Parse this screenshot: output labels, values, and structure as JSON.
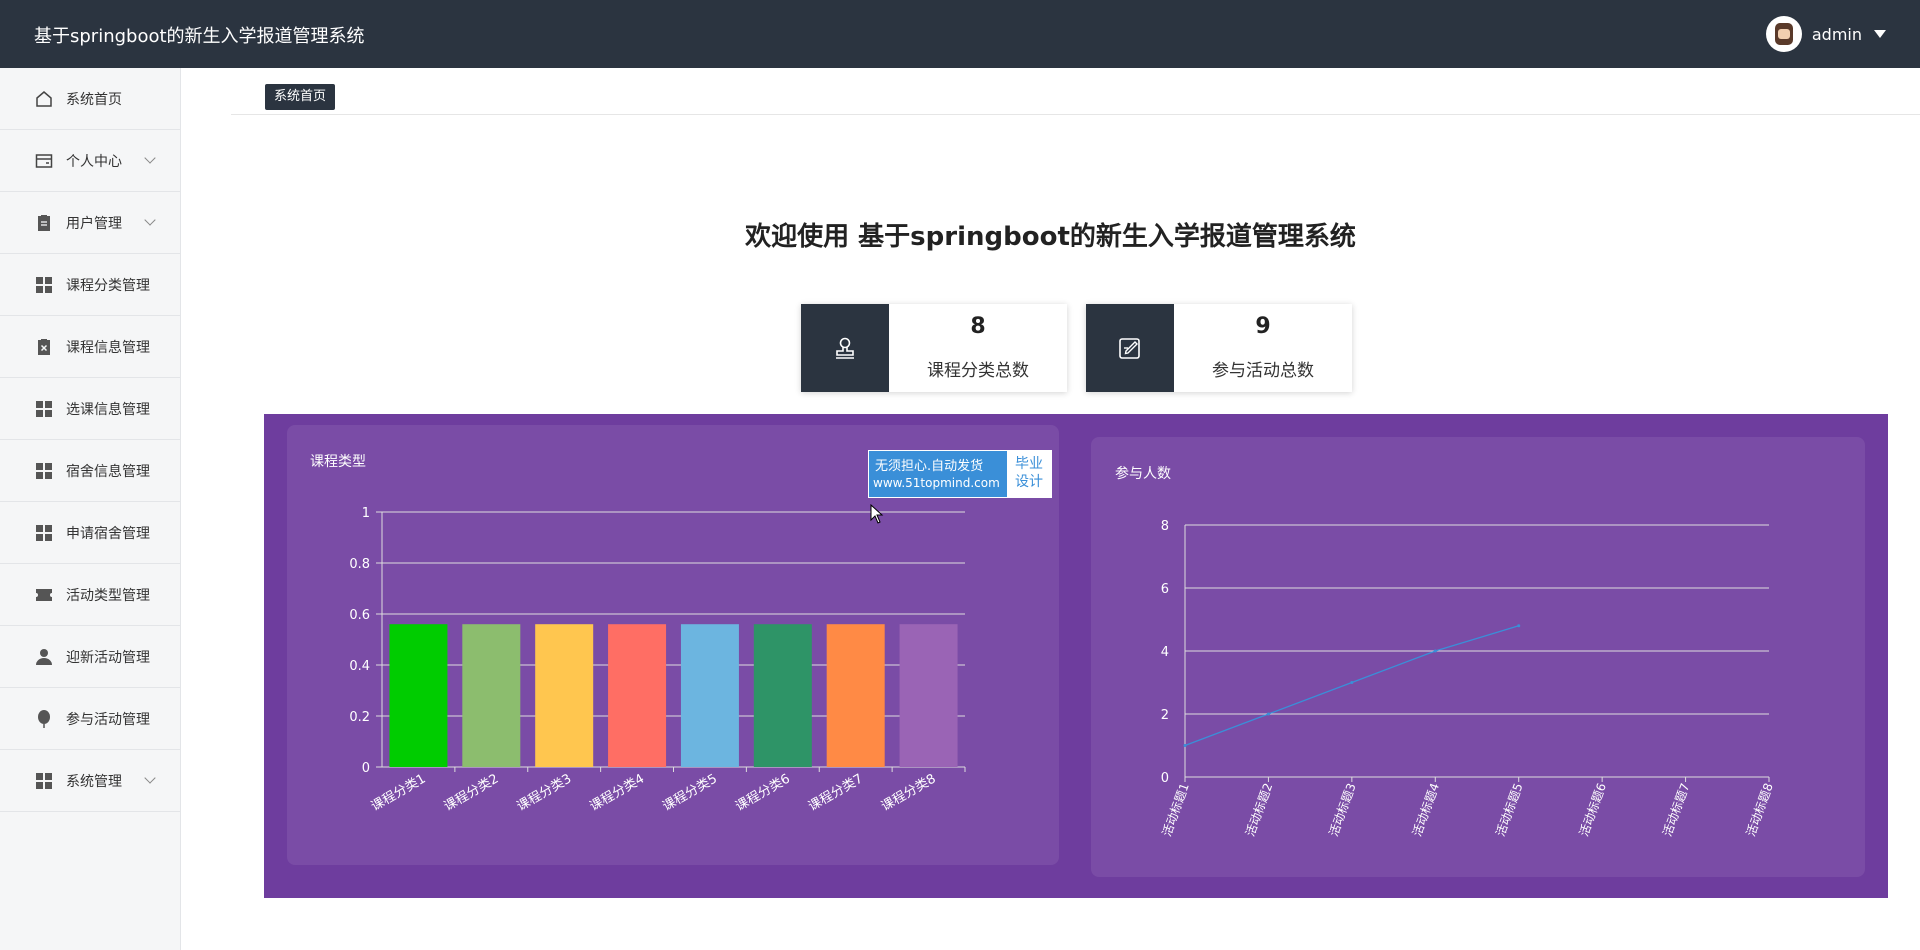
{
  "header": {
    "title": "基于springboot的新生入学报道管理系统",
    "username": "admin"
  },
  "sidebar": {
    "items": [
      {
        "label": "系统首页",
        "icon": "home-icon"
      },
      {
        "label": "个人中心",
        "icon": "wallet-icon",
        "expandable": true
      },
      {
        "label": "用户管理",
        "icon": "clipboard-icon",
        "expandable": true
      },
      {
        "label": "课程分类管理",
        "icon": "grid-icon"
      },
      {
        "label": "课程信息管理",
        "icon": "clipboard-x-icon"
      },
      {
        "label": "选课信息管理",
        "icon": "grid-icon"
      },
      {
        "label": "宿舍信息管理",
        "icon": "grid-icon"
      },
      {
        "label": "申请宿舍管理",
        "icon": "grid-icon"
      },
      {
        "label": "活动类型管理",
        "icon": "ticket-icon"
      },
      {
        "label": "迎新活动管理",
        "icon": "user-icon"
      },
      {
        "label": "参与活动管理",
        "icon": "balloon-icon"
      },
      {
        "label": "系统管理",
        "icon": "grid-icon",
        "expandable": true
      }
    ]
  },
  "breadcrumb": {
    "current": "系统首页"
  },
  "main": {
    "welcome": "欢迎使用 基于springboot的新生入学报道管理系统"
  },
  "stats": [
    {
      "value": "8",
      "label": "课程分类总数",
      "icon": "stamp-icon"
    },
    {
      "value": "9",
      "label": "参与活动总数",
      "icon": "edit-note-icon"
    }
  ],
  "ad": {
    "line1": "无须担心.自动发货",
    "line2": "www.51topmind.com",
    "tag1": "毕业",
    "tag2": "设计"
  },
  "colors": {
    "header_bg": "#2b3440",
    "panel_bg": "#6e3d9e",
    "card_bg": "#7a4ca6"
  },
  "chart_data": [
    {
      "type": "bar",
      "title": "课程类型",
      "categories": [
        "课程分类1",
        "课程分类2",
        "课程分类3",
        "课程分类4",
        "课程分类5",
        "课程分类6",
        "课程分类7",
        "课程分类8"
      ],
      "values": [
        0.56,
        0.56,
        0.56,
        0.56,
        0.56,
        0.56,
        0.56,
        0.56
      ],
      "colors": [
        "#00cc00",
        "#8cbd6e",
        "#ffc64f",
        "#ff6e64",
        "#6cb5e0",
        "#2e9467",
        "#ff8a45",
        "#9a64b5"
      ],
      "ylim": [
        0,
        1
      ],
      "yticks": [
        0,
        0.2,
        0.4,
        0.6,
        0.8,
        1
      ],
      "ytick_labels": [
        "0",
        "0.2",
        "0.4",
        "0.6",
        "0.8",
        "1"
      ],
      "grid": true
    },
    {
      "type": "line",
      "title": "参与人数",
      "categories": [
        "活动标题1",
        "活动标题2",
        "活动标题3",
        "活动标题4",
        "活动标题5",
        "活动标题6",
        "活动标题7",
        "活动标题8"
      ],
      "values": [
        1,
        2,
        3,
        4,
        4.8
      ],
      "ylim": [
        0,
        8
      ],
      "yticks": [
        0,
        2,
        4,
        6,
        8
      ],
      "grid": true,
      "color": "#3a8fd8"
    }
  ]
}
